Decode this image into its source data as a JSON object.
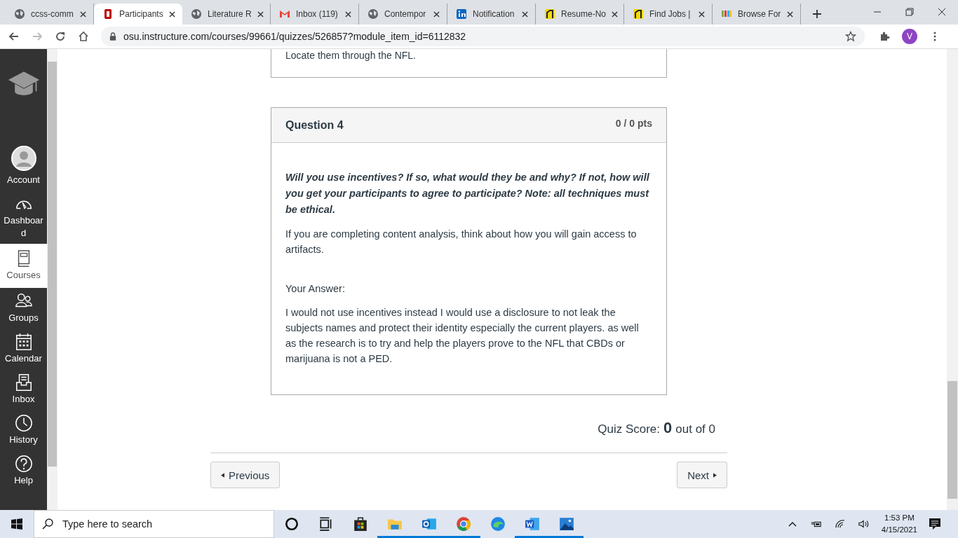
{
  "browser": {
    "tabs": [
      {
        "label": "ccss-comm",
        "kind": "globe",
        "selected": false
      },
      {
        "label": "Participants",
        "kind": "osu",
        "selected": true
      },
      {
        "label": "Literature R",
        "kind": "globe",
        "selected": false
      },
      {
        "label": "Inbox (119)",
        "kind": "mail",
        "selected": false
      },
      {
        "label": "Contempor",
        "kind": "globe",
        "selected": false
      },
      {
        "label": "Notification",
        "kind": "linkedin",
        "selected": false
      },
      {
        "label": "Resume-No",
        "kind": "handshake",
        "selected": false
      },
      {
        "label": "Find Jobs |",
        "kind": "handshake",
        "selected": false
      },
      {
        "label": "Browse For",
        "kind": "colorful",
        "selected": false
      }
    ],
    "url": "osu.instructure.com/courses/99661/quizzes/526857?module_item_id=6112832",
    "profile_initial": "V"
  },
  "sidebar": {
    "items": [
      {
        "label": "Account",
        "kind": "avatar",
        "selected": false
      },
      {
        "label": "Dashboard",
        "kind": "dashboard",
        "selected": false
      },
      {
        "label": "Courses",
        "kind": "courses",
        "selected": true
      },
      {
        "label": "Groups",
        "kind": "groups",
        "selected": false
      },
      {
        "label": "Calendar",
        "kind": "calendar",
        "selected": false
      },
      {
        "label": "Inbox",
        "kind": "inbox",
        "selected": false
      },
      {
        "label": "History",
        "kind": "history",
        "selected": false
      },
      {
        "label": "Help",
        "kind": "help",
        "selected": false
      }
    ]
  },
  "previous_answer": "Locate them through the NFL.",
  "question": {
    "title": "Question 4",
    "points": "0 / 0 pts",
    "prompt": "Will you use incentives? If so, what would they be and why? If not, how will you get your participants to agree to participate? Note: all techniques must be ethical.",
    "hint": "If you are completing content analysis, think about how you will gain access to artifacts.",
    "answer_label": "Your Answer:",
    "answer": "I would not use incentives instead I would use a disclosure to not leak the subjects names and protect their identity especially the current players. as well as the research is to try and help the players prove to the NFL that CBDs or marijuana is not a PED."
  },
  "quiz_score": {
    "label": "Quiz Score:",
    "score": "0",
    "total": "out of 0"
  },
  "nav": {
    "previous": "Previous",
    "next": "Next"
  },
  "taskbar": {
    "search_placeholder": "Type here to search",
    "apps": [
      {
        "kind": "cortana",
        "running": false
      },
      {
        "kind": "taskview",
        "running": false
      },
      {
        "kind": "store",
        "running": false
      },
      {
        "kind": "explorer",
        "running": true
      },
      {
        "kind": "outlook",
        "running": true
      },
      {
        "kind": "chrome",
        "running": true
      },
      {
        "kind": "edge",
        "running": false
      },
      {
        "kind": "word",
        "running": true
      },
      {
        "kind": "photos",
        "running": true
      }
    ],
    "time": "1:53 PM",
    "date": "4/15/2021"
  }
}
